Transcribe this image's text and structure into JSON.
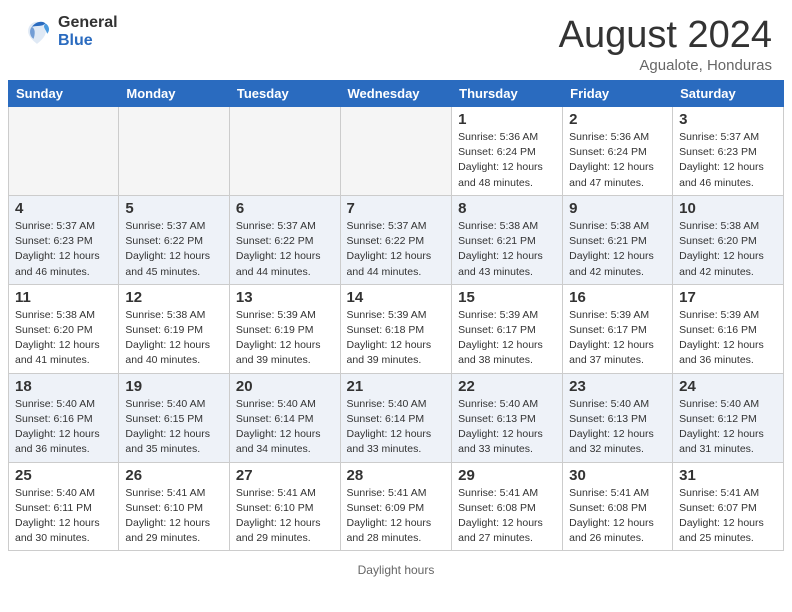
{
  "header": {
    "logo_general": "General",
    "logo_blue": "Blue",
    "month_title": "August 2024",
    "location": "Agualote, Honduras"
  },
  "days_of_week": [
    "Sunday",
    "Monday",
    "Tuesday",
    "Wednesday",
    "Thursday",
    "Friday",
    "Saturday"
  ],
  "weeks": [
    [
      {
        "day": "",
        "info": ""
      },
      {
        "day": "",
        "info": ""
      },
      {
        "day": "",
        "info": ""
      },
      {
        "day": "",
        "info": ""
      },
      {
        "day": "1",
        "info": "Sunrise: 5:36 AM\nSunset: 6:24 PM\nDaylight: 12 hours\nand 48 minutes."
      },
      {
        "day": "2",
        "info": "Sunrise: 5:36 AM\nSunset: 6:24 PM\nDaylight: 12 hours\nand 47 minutes."
      },
      {
        "day": "3",
        "info": "Sunrise: 5:37 AM\nSunset: 6:23 PM\nDaylight: 12 hours\nand 46 minutes."
      }
    ],
    [
      {
        "day": "4",
        "info": "Sunrise: 5:37 AM\nSunset: 6:23 PM\nDaylight: 12 hours\nand 46 minutes."
      },
      {
        "day": "5",
        "info": "Sunrise: 5:37 AM\nSunset: 6:22 PM\nDaylight: 12 hours\nand 45 minutes."
      },
      {
        "day": "6",
        "info": "Sunrise: 5:37 AM\nSunset: 6:22 PM\nDaylight: 12 hours\nand 44 minutes."
      },
      {
        "day": "7",
        "info": "Sunrise: 5:37 AM\nSunset: 6:22 PM\nDaylight: 12 hours\nand 44 minutes."
      },
      {
        "day": "8",
        "info": "Sunrise: 5:38 AM\nSunset: 6:21 PM\nDaylight: 12 hours\nand 43 minutes."
      },
      {
        "day": "9",
        "info": "Sunrise: 5:38 AM\nSunset: 6:21 PM\nDaylight: 12 hours\nand 42 minutes."
      },
      {
        "day": "10",
        "info": "Sunrise: 5:38 AM\nSunset: 6:20 PM\nDaylight: 12 hours\nand 42 minutes."
      }
    ],
    [
      {
        "day": "11",
        "info": "Sunrise: 5:38 AM\nSunset: 6:20 PM\nDaylight: 12 hours\nand 41 minutes."
      },
      {
        "day": "12",
        "info": "Sunrise: 5:38 AM\nSunset: 6:19 PM\nDaylight: 12 hours\nand 40 minutes."
      },
      {
        "day": "13",
        "info": "Sunrise: 5:39 AM\nSunset: 6:19 PM\nDaylight: 12 hours\nand 39 minutes."
      },
      {
        "day": "14",
        "info": "Sunrise: 5:39 AM\nSunset: 6:18 PM\nDaylight: 12 hours\nand 39 minutes."
      },
      {
        "day": "15",
        "info": "Sunrise: 5:39 AM\nSunset: 6:17 PM\nDaylight: 12 hours\nand 38 minutes."
      },
      {
        "day": "16",
        "info": "Sunrise: 5:39 AM\nSunset: 6:17 PM\nDaylight: 12 hours\nand 37 minutes."
      },
      {
        "day": "17",
        "info": "Sunrise: 5:39 AM\nSunset: 6:16 PM\nDaylight: 12 hours\nand 36 minutes."
      }
    ],
    [
      {
        "day": "18",
        "info": "Sunrise: 5:40 AM\nSunset: 6:16 PM\nDaylight: 12 hours\nand 36 minutes."
      },
      {
        "day": "19",
        "info": "Sunrise: 5:40 AM\nSunset: 6:15 PM\nDaylight: 12 hours\nand 35 minutes."
      },
      {
        "day": "20",
        "info": "Sunrise: 5:40 AM\nSunset: 6:14 PM\nDaylight: 12 hours\nand 34 minutes."
      },
      {
        "day": "21",
        "info": "Sunrise: 5:40 AM\nSunset: 6:14 PM\nDaylight: 12 hours\nand 33 minutes."
      },
      {
        "day": "22",
        "info": "Sunrise: 5:40 AM\nSunset: 6:13 PM\nDaylight: 12 hours\nand 33 minutes."
      },
      {
        "day": "23",
        "info": "Sunrise: 5:40 AM\nSunset: 6:13 PM\nDaylight: 12 hours\nand 32 minutes."
      },
      {
        "day": "24",
        "info": "Sunrise: 5:40 AM\nSunset: 6:12 PM\nDaylight: 12 hours\nand 31 minutes."
      }
    ],
    [
      {
        "day": "25",
        "info": "Sunrise: 5:40 AM\nSunset: 6:11 PM\nDaylight: 12 hours\nand 30 minutes."
      },
      {
        "day": "26",
        "info": "Sunrise: 5:41 AM\nSunset: 6:10 PM\nDaylight: 12 hours\nand 29 minutes."
      },
      {
        "day": "27",
        "info": "Sunrise: 5:41 AM\nSunset: 6:10 PM\nDaylight: 12 hours\nand 29 minutes."
      },
      {
        "day": "28",
        "info": "Sunrise: 5:41 AM\nSunset: 6:09 PM\nDaylight: 12 hours\nand 28 minutes."
      },
      {
        "day": "29",
        "info": "Sunrise: 5:41 AM\nSunset: 6:08 PM\nDaylight: 12 hours\nand 27 minutes."
      },
      {
        "day": "30",
        "info": "Sunrise: 5:41 AM\nSunset: 6:08 PM\nDaylight: 12 hours\nand 26 minutes."
      },
      {
        "day": "31",
        "info": "Sunrise: 5:41 AM\nSunset: 6:07 PM\nDaylight: 12 hours\nand 25 minutes."
      }
    ]
  ],
  "footer": {
    "daylight_note": "Daylight hours"
  }
}
